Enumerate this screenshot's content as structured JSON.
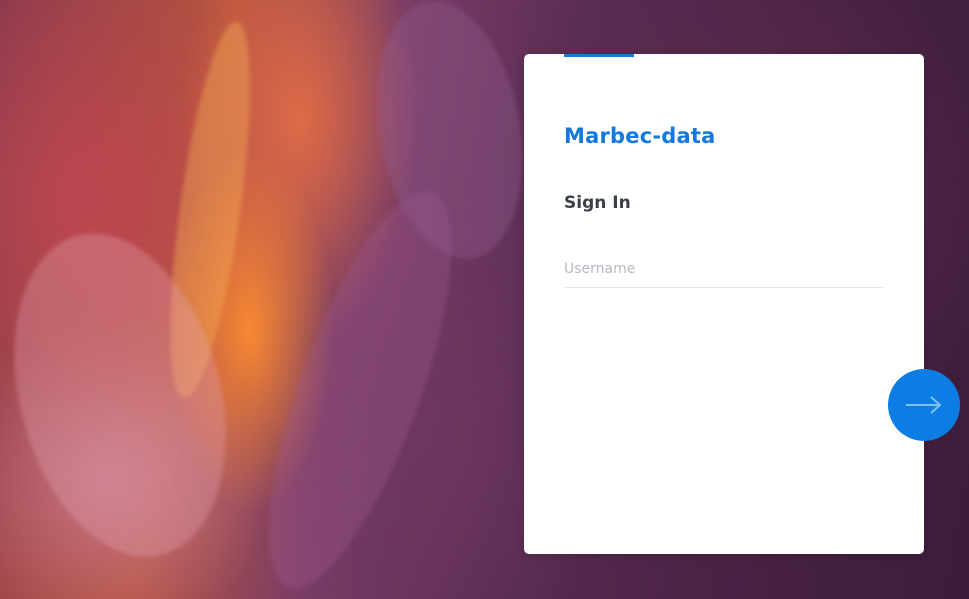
{
  "card": {
    "brand": "Marbec-data",
    "heading": "Sign In"
  },
  "username": {
    "placeholder": "Username",
    "value": ""
  },
  "next_button": {
    "icon": "arrow-right-icon"
  },
  "colors": {
    "accent": "#0f7bdf",
    "button": "#0d7de6",
    "heading_text": "#3b3f47"
  }
}
